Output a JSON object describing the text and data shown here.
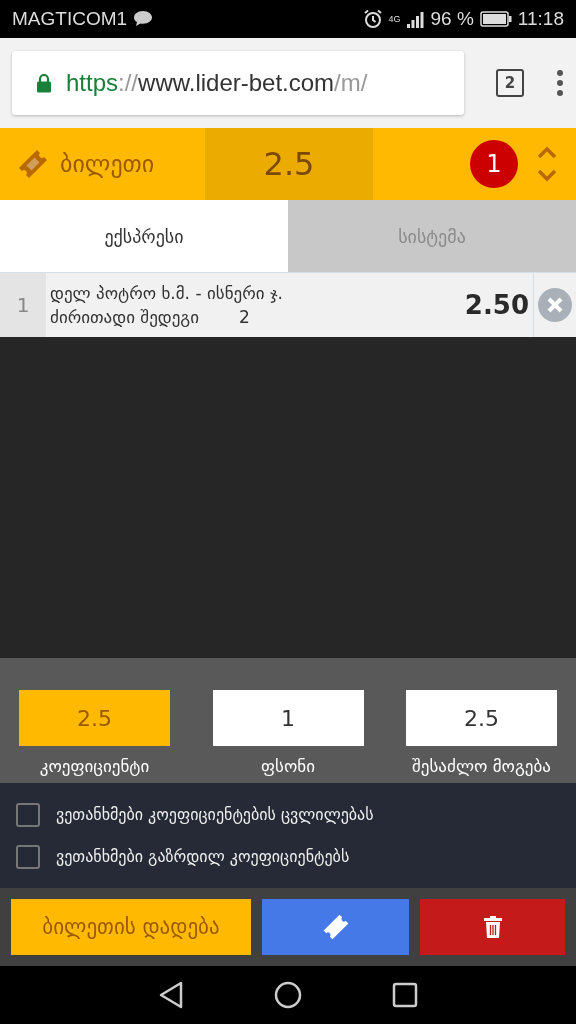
{
  "status_bar": {
    "carrier": "MAGTICOM1",
    "network": "4G",
    "battery": "96 %",
    "time": "11:18"
  },
  "browser": {
    "url": {
      "scheme": "https",
      "separator": "://",
      "host": "www.lider-bet.com",
      "path": "/m/"
    },
    "tab_count": "2"
  },
  "ticket_header": {
    "title": "ბილეთი",
    "total_odds": "2.5",
    "count": "1"
  },
  "tabs": [
    {
      "label": "ექსპრესი",
      "selected": true
    },
    {
      "label": "სისტემა",
      "selected": false
    }
  ],
  "bets": [
    {
      "number": "1",
      "event": "დელ პოტრო ხ.მ. - ისნერი ჯ.",
      "market": "ძირითადი შედეგი",
      "pick": "2",
      "odds": "2.50"
    }
  ],
  "summary": [
    {
      "value": "2.5",
      "label": "კოეფიციენტი",
      "highlighted": true
    },
    {
      "value": "1",
      "label": "ფსონი",
      "highlighted": false
    },
    {
      "value": "2.5",
      "label": "შესაძლო მოგება",
      "highlighted": false
    }
  ],
  "options": [
    {
      "label": "ვეთანხმები კოეფიციენტების ცვლილებას",
      "checked": false
    },
    {
      "label": "ვეთანხმები გაზრდილ კოეფიციენტებს",
      "checked": false
    }
  ],
  "actions": {
    "place_bet": "ბილეთის დადება"
  }
}
